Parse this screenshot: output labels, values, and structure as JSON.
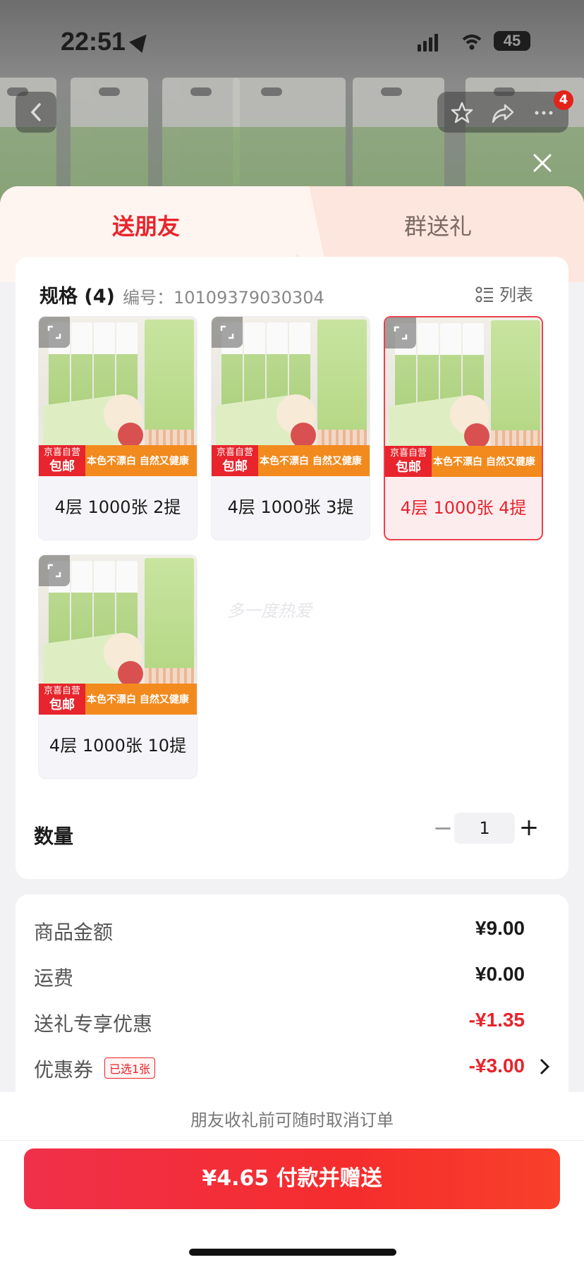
{
  "status_bar": {
    "time": "22:51",
    "battery": "45"
  },
  "nav": {
    "badge_count": "4",
    "icons": [
      "back-icon",
      "star-icon",
      "share-icon",
      "more-icon",
      "close-icon"
    ]
  },
  "tabs": [
    {
      "label": "送朋友",
      "active": true
    },
    {
      "label": "群送礼",
      "active": false
    }
  ],
  "spec": {
    "title": "规格 (4)",
    "code": "编号：10109379030304",
    "list_toggle": "列表",
    "items": [
      {
        "label": "4层 1000张 2提",
        "selected": false
      },
      {
        "label": "4层 1000张 3提",
        "selected": false
      },
      {
        "label": "4层 1000张 4提",
        "selected": true
      },
      {
        "label": "4层 1000张 10提",
        "selected": false
      }
    ],
    "ship_tag_line1": "京喜自营",
    "ship_tag_line2": "包邮",
    "ship_slogan": "本色不漂白 自然又健康"
  },
  "watermark": "多一度热爱",
  "quantity": {
    "label": "数量",
    "minus": "−",
    "value": "1",
    "plus": "+"
  },
  "price": {
    "rows": [
      {
        "key": "商品金额",
        "value": "¥9.00",
        "red": false
      },
      {
        "key": "运费",
        "value": "¥0.00",
        "red": false
      },
      {
        "key": "送礼专享优惠",
        "value": "-¥1.35",
        "red": true
      },
      {
        "key": "优惠券",
        "value": "-¥3.00",
        "red": true,
        "tag": "已选1张"
      }
    ]
  },
  "footer": {
    "note": "朋友收礼前可随时取消订单",
    "pay_button": "¥4.65 付款并赠送"
  },
  "colors": {
    "accent": "#e8242c",
    "ship_orange": "#f28a1e"
  }
}
